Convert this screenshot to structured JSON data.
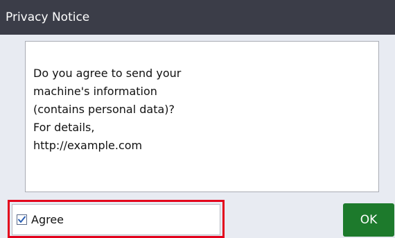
{
  "dialog": {
    "title": "Privacy Notice",
    "message": "Do you agree to send your\nmachine's information\n(contains personal data)?\nFor details,\nhttp://example.com"
  },
  "agree": {
    "label": "Agree",
    "checked": true,
    "highlight_color": "#e3001b"
  },
  "ok_button": {
    "label": "OK",
    "color": "#1d7a2c"
  },
  "icons": {
    "check": "check-icon"
  }
}
